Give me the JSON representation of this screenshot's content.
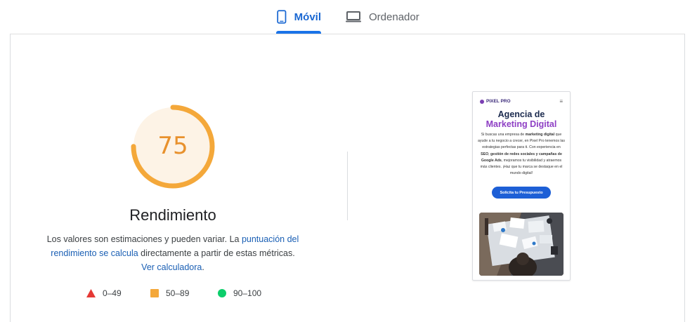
{
  "tabs": {
    "mobile_label": "Móvil",
    "desktop_label": "Ordenador",
    "selected": "mobile"
  },
  "score": {
    "value": 75,
    "fraction": 0.75,
    "display": "75",
    "color": "#f4a83a",
    "fill_color": "#fdf3e6",
    "text_color": "#e8912d"
  },
  "category_title": "Rendimiento",
  "description": {
    "part1": "Los valores son estimaciones y pueden variar. La ",
    "link1": "puntuación del rendimiento se calcula",
    "part2": " directamente a partir de estas métricas. ",
    "link2": "Ver calculadora",
    "part3": "."
  },
  "legend": [
    {
      "range": "0–49",
      "shape": "triangle",
      "color": "#e53935"
    },
    {
      "range": "50–89",
      "shape": "square",
      "color": "#f4a83a"
    },
    {
      "range": "90–100",
      "shape": "circle",
      "color": "#0cce6b"
    }
  ],
  "screenshot": {
    "brand": "PIXEL PRO",
    "menu_icon": "hamburger-icon",
    "heading_line1": "Agencia de",
    "heading_line2": "Marketing Digital",
    "body_segments": [
      {
        "text": "Si buscas una empresa de ",
        "bold": false
      },
      {
        "text": "marketing digital",
        "bold": true
      },
      {
        "text": " que ayude a tu negocio a crecer, en Pixel Pro tenemos las estrategias perfectas para ti. Con experiencia en ",
        "bold": false
      },
      {
        "text": "SEO",
        "bold": true
      },
      {
        "text": ", ",
        "bold": false
      },
      {
        "text": "gestión de redes sociales",
        "bold": true
      },
      {
        "text": " y ",
        "bold": true
      },
      {
        "text": "campañas de Google Ads",
        "bold": true
      },
      {
        "text": ", mejoramos tu visibilidad y atraemos más clientes. ¡Haz que tu marca se destaque en el mundo digital!",
        "bold": false
      }
    ],
    "cta_label": "Solicita tu Presupuesto",
    "cta_color": "#1d5fd6",
    "image_subject": "office-meeting-photo"
  }
}
